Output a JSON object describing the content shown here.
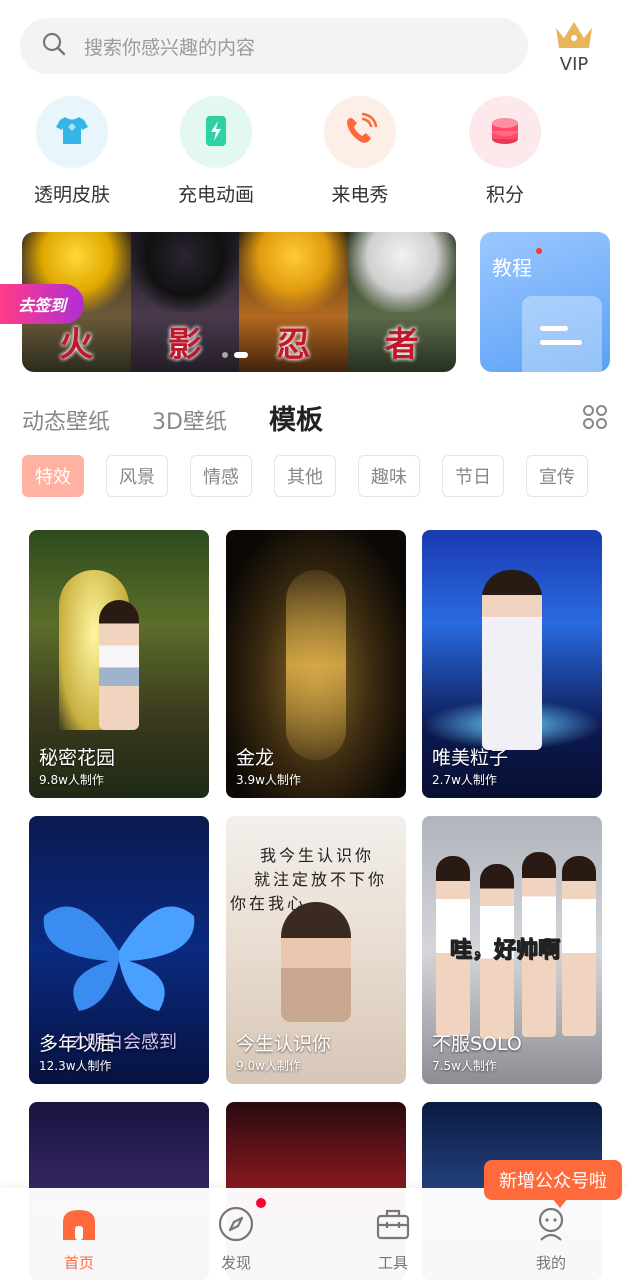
{
  "search": {
    "placeholder": "搜索你感兴趣的内容"
  },
  "vip": {
    "label": "VIP"
  },
  "shortcuts": [
    {
      "label": "透明皮肤",
      "icon": "shirt-icon",
      "color": "#34b5e8"
    },
    {
      "label": "充电动画",
      "icon": "battery-charge-icon",
      "color": "#2ed1a3"
    },
    {
      "label": "来电秀",
      "icon": "phone-ring-icon",
      "color": "#ff6a3d"
    },
    {
      "label": "积分",
      "icon": "coin-stack-icon",
      "color": "#ff4b6a"
    }
  ],
  "banner": {
    "panels": [
      "火",
      "影",
      "忍",
      "者"
    ],
    "signin": "去签到"
  },
  "tutorial": {
    "label": "教程"
  },
  "tabs": [
    "动态壁纸",
    "3D壁纸",
    "模板"
  ],
  "chips": [
    "特效",
    "风景",
    "情感",
    "其他",
    "趣味",
    "节日",
    "宣传"
  ],
  "cards": [
    {
      "title": "秘密花园",
      "count": "9.8w人制作"
    },
    {
      "title": "金龙",
      "count": "3.9w人制作"
    },
    {
      "title": "唯美粒子",
      "count": "2.7w人制作"
    },
    {
      "title": "多年以后",
      "count": "12.3w人制作",
      "overlay": "才明白会感到"
    },
    {
      "title": "今生认识你",
      "count": "9.0w人制作",
      "overlay_lines": [
        "我今生认识你",
        "就注定放不下你",
        "你在我心"
      ]
    },
    {
      "title": "不服SOLO",
      "count": "7.5w人制作",
      "overlay": "哇，好帅啊"
    }
  ],
  "nav": [
    {
      "label": "首页",
      "icon": "home-icon"
    },
    {
      "label": "发现",
      "icon": "compass-icon"
    },
    {
      "label": "工具",
      "icon": "toolbox-icon"
    },
    {
      "label": "我的",
      "icon": "profile-icon"
    }
  ],
  "toast": "新增公众号啦",
  "colors": {
    "accent": "#ff6a3d",
    "chip_active": "#ffb1a2"
  }
}
